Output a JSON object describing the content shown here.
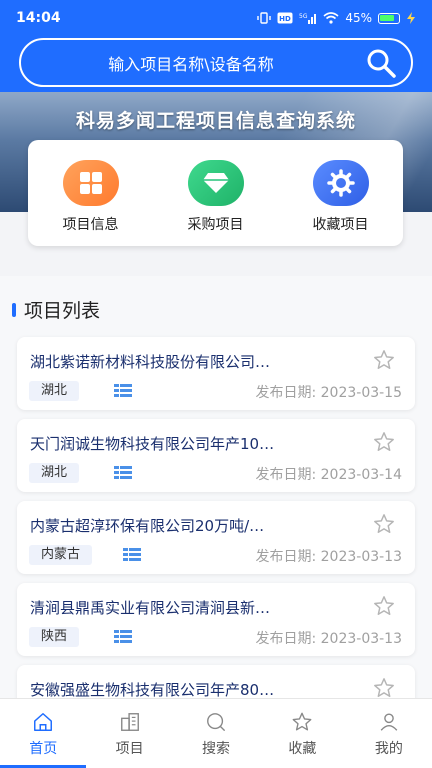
{
  "status_bar": {
    "time": "14:04",
    "battery": "45%",
    "icons": [
      "vibrate-icon",
      "hd-icon",
      "5g-signal-icon",
      "wifi-icon",
      "battery-icon",
      "charging-icon"
    ]
  },
  "search": {
    "placeholder": "输入项目名称\\设备名称",
    "icon": "search-icon"
  },
  "banner": {
    "title": "科易多闻工程项目信息查询系统"
  },
  "quick_menu": [
    {
      "label": "项目信息",
      "icon": "grid-icon",
      "color": "#ff8a3d"
    },
    {
      "label": "采购项目",
      "icon": "diamond-icon",
      "color": "#27c47a"
    },
    {
      "label": "收藏项目",
      "icon": "gear-icon",
      "color": "#3d6ff0"
    }
  ],
  "section": {
    "title": "项目列表"
  },
  "projects": [
    {
      "title": "湖北紫诺新材料科技股份有限公司…",
      "region": "湖北",
      "date": "发布日期: 2023-03-15"
    },
    {
      "title": "天门润诚生物科技有限公司年产10…",
      "region": "湖北",
      "date": "发布日期: 2023-03-14"
    },
    {
      "title": "内蒙古超淳环保有限公司20万吨/…",
      "region": "内蒙古",
      "date": "发布日期: 2023-03-13"
    },
    {
      "title": "清涧县鼎禹实业有限公司清涧县新…",
      "region": "陕西",
      "date": "发布日期: 2023-03-13"
    },
    {
      "title": "安徽强盛生物科技有限公司年产80…",
      "region": "",
      "date": ""
    }
  ],
  "bottom_nav": [
    {
      "label": "首页",
      "icon": "home-icon",
      "active": true
    },
    {
      "label": "项目",
      "icon": "building-icon",
      "active": false
    },
    {
      "label": "搜索",
      "icon": "chat-search-icon",
      "active": false
    },
    {
      "label": "收藏",
      "icon": "star-icon",
      "active": false
    },
    {
      "label": "我的",
      "icon": "user-icon",
      "active": false
    }
  ],
  "colors": {
    "primary": "#1f6dff",
    "title_text": "#1a2f6e",
    "date_text": "#a0a0a0"
  }
}
